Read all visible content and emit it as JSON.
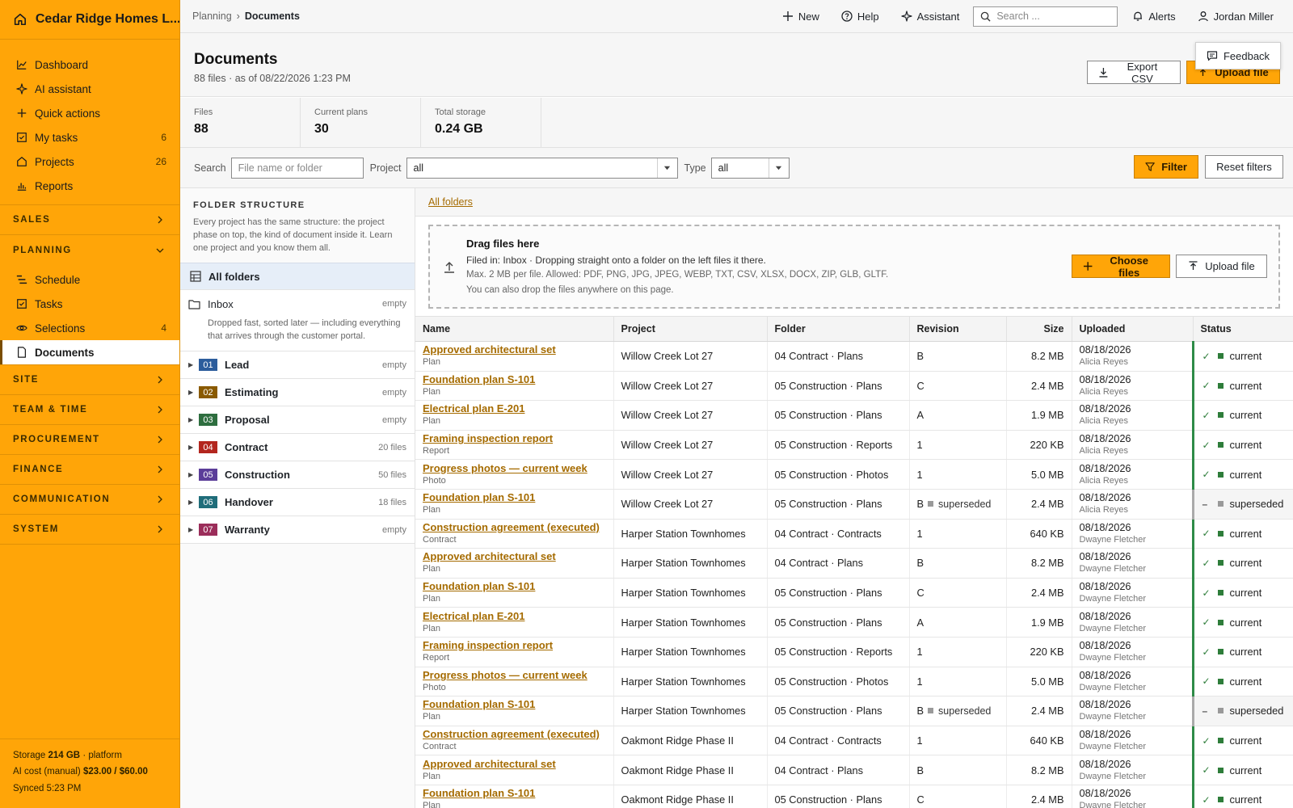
{
  "brand": {
    "name": "Cedar Ridge Homes L..."
  },
  "nav": {
    "top": [
      {
        "label": "Dashboard",
        "icon": "chart-line-icon",
        "count": ""
      },
      {
        "label": "AI assistant",
        "icon": "sparkle-icon",
        "count": ""
      },
      {
        "label": "Quick actions",
        "icon": "plus-icon",
        "count": ""
      },
      {
        "label": "My tasks",
        "icon": "checkbox-icon",
        "count": "6"
      },
      {
        "label": "Projects",
        "icon": "home-icon",
        "count": "26"
      },
      {
        "label": "Reports",
        "icon": "bar-chart-icon",
        "count": ""
      }
    ],
    "sections": {
      "sales": "SALES",
      "planning": "PLANNING",
      "site": "SITE",
      "team_time": "TEAM & TIME",
      "procurement": "PROCUREMENT",
      "finance": "FINANCE",
      "communication": "COMMUNICATION",
      "system": "SYSTEM"
    },
    "planning_items": [
      {
        "label": "Schedule",
        "count": ""
      },
      {
        "label": "Tasks",
        "count": ""
      },
      {
        "label": "Selections",
        "count": "4"
      },
      {
        "label": "Documents",
        "count": ""
      }
    ]
  },
  "footer": {
    "storage_label": "Storage",
    "storage_value": "214 GB",
    "storage_suffix": "· platform",
    "ai_label": "AI cost (manual)",
    "ai_value": "$23.00 / $60.00",
    "synced": "Synced 5:23 PM"
  },
  "topbar": {
    "crumb_parent": "Planning",
    "crumb_sep": "›",
    "crumb_current": "Documents",
    "new_label": "New",
    "help_label": "Help",
    "assistant_label": "Assistant",
    "search_placeholder": "Search ...",
    "alerts_label": "Alerts",
    "user_name": "Jordan Miller"
  },
  "header": {
    "title": "Documents",
    "subtitle": "88 files · as of 08/22/2026 1:23 PM",
    "export_label": "Export CSV",
    "upload_label": "Upload file",
    "feedback_label": "Feedback"
  },
  "stats": [
    {
      "label": "Files",
      "value": "88"
    },
    {
      "label": "Current plans",
      "value": "30"
    },
    {
      "label": "Total storage",
      "value": "0.24 GB"
    }
  ],
  "filters": {
    "search_label": "Search",
    "search_placeholder": "File name or folder",
    "project_label": "Project",
    "project_value": "all",
    "type_label": "Type",
    "type_value": "all",
    "filter_label": "Filter",
    "reset_label": "Reset filters"
  },
  "folders": {
    "title": "FOLDER STRUCTURE",
    "description": "Every project has the same structure: the project phase on top, the kind of document inside it. Learn one project and you know them all.",
    "all_label": "All folders",
    "inbox_label": "Inbox",
    "inbox_count": "empty",
    "inbox_note": "Dropped fast, sorted later — including everything that arrives through the customer portal.",
    "phases": [
      {
        "num": "01",
        "name": "Lead",
        "count": "empty",
        "color": "#2c5d9c"
      },
      {
        "num": "02",
        "name": "Estimating",
        "count": "empty",
        "color": "#8a5a00"
      },
      {
        "num": "03",
        "name": "Proposal",
        "count": "empty",
        "color": "#2e6e3f"
      },
      {
        "num": "04",
        "name": "Contract",
        "count": "20 files",
        "color": "#b3261e"
      },
      {
        "num": "05",
        "name": "Construction",
        "count": "50 files",
        "color": "#5b3d99"
      },
      {
        "num": "06",
        "name": "Handover",
        "count": "18 files",
        "color": "#1f6d7a"
      },
      {
        "num": "07",
        "name": "Warranty",
        "count": "empty",
        "color": "#9b2d5a"
      }
    ]
  },
  "main": {
    "all_folders_link": "All folders",
    "drop": {
      "title": "Drag files here",
      "line1": "Filed in: Inbox · Dropping straight onto a folder on the left files it there.",
      "line2": "Max. 2 MB per file. Allowed: PDF, PNG, JPG, JPEG, WEBP, TXT, CSV, XLSX, DOCX, ZIP, GLB, GLTF.",
      "line3": "You can also drop the files anywhere on this page.",
      "choose_label": "Choose files",
      "upload_label": "Upload file"
    }
  },
  "table": {
    "headers": {
      "name": "Name",
      "project": "Project",
      "folder": "Folder",
      "revision": "Revision",
      "size": "Size",
      "uploaded": "Uploaded",
      "status": "Status"
    },
    "rows": [
      {
        "name": "Approved architectural set",
        "cat": "Plan",
        "project": "Willow Creek Lot 27",
        "folder": "04 Contract · Plans",
        "rev": "B",
        "rev_status": "",
        "size": "8.2 MB",
        "date": "08/18/2026",
        "user": "Alicia Reyes",
        "status": "current"
      },
      {
        "name": "Foundation plan S-101",
        "cat": "Plan",
        "project": "Willow Creek Lot 27",
        "folder": "05 Construction · Plans",
        "rev": "C",
        "rev_status": "",
        "size": "2.4 MB",
        "date": "08/18/2026",
        "user": "Alicia Reyes",
        "status": "current"
      },
      {
        "name": "Electrical plan E-201",
        "cat": "Plan",
        "project": "Willow Creek Lot 27",
        "folder": "05 Construction · Plans",
        "rev": "A",
        "rev_status": "",
        "size": "1.9 MB",
        "date": "08/18/2026",
        "user": "Alicia Reyes",
        "status": "current"
      },
      {
        "name": "Framing inspection report",
        "cat": "Report",
        "project": "Willow Creek Lot 27",
        "folder": "05 Construction · Reports",
        "rev": "1",
        "rev_status": "",
        "size": "220 KB",
        "date": "08/18/2026",
        "user": "Alicia Reyes",
        "status": "current"
      },
      {
        "name": "Progress photos — current week",
        "cat": "Photo",
        "project": "Willow Creek Lot 27",
        "folder": "05 Construction · Photos",
        "rev": "1",
        "rev_status": "",
        "size": "5.0 MB",
        "date": "08/18/2026",
        "user": "Alicia Reyes",
        "status": "current"
      },
      {
        "name": "Foundation plan S-101",
        "cat": "Plan",
        "project": "Willow Creek Lot 27",
        "folder": "05 Construction · Plans",
        "rev": "B",
        "rev_status": "superseded",
        "size": "2.4 MB",
        "date": "08/18/2026",
        "user": "Alicia Reyes",
        "status": "superseded"
      },
      {
        "name": "Construction agreement (executed)",
        "cat": "Contract",
        "project": "Harper Station Townhomes",
        "folder": "04 Contract · Contracts",
        "rev": "1",
        "rev_status": "",
        "size": "640 KB",
        "date": "08/18/2026",
        "user": "Dwayne Fletcher",
        "status": "current"
      },
      {
        "name": "Approved architectural set",
        "cat": "Plan",
        "project": "Harper Station Townhomes",
        "folder": "04 Contract · Plans",
        "rev": "B",
        "rev_status": "",
        "size": "8.2 MB",
        "date": "08/18/2026",
        "user": "Dwayne Fletcher",
        "status": "current"
      },
      {
        "name": "Foundation plan S-101",
        "cat": "Plan",
        "project": "Harper Station Townhomes",
        "folder": "05 Construction · Plans",
        "rev": "C",
        "rev_status": "",
        "size": "2.4 MB",
        "date": "08/18/2026",
        "user": "Dwayne Fletcher",
        "status": "current"
      },
      {
        "name": "Electrical plan E-201",
        "cat": "Plan",
        "project": "Harper Station Townhomes",
        "folder": "05 Construction · Plans",
        "rev": "A",
        "rev_status": "",
        "size": "1.9 MB",
        "date": "08/18/2026",
        "user": "Dwayne Fletcher",
        "status": "current"
      },
      {
        "name": "Framing inspection report",
        "cat": "Report",
        "project": "Harper Station Townhomes",
        "folder": "05 Construction · Reports",
        "rev": "1",
        "rev_status": "",
        "size": "220 KB",
        "date": "08/18/2026",
        "user": "Dwayne Fletcher",
        "status": "current"
      },
      {
        "name": "Progress photos — current week",
        "cat": "Photo",
        "project": "Harper Station Townhomes",
        "folder": "05 Construction · Photos",
        "rev": "1",
        "rev_status": "",
        "size": "5.0 MB",
        "date": "08/18/2026",
        "user": "Dwayne Fletcher",
        "status": "current"
      },
      {
        "name": "Foundation plan S-101",
        "cat": "Plan",
        "project": "Harper Station Townhomes",
        "folder": "05 Construction · Plans",
        "rev": "B",
        "rev_status": "superseded",
        "size": "2.4 MB",
        "date": "08/18/2026",
        "user": "Dwayne Fletcher",
        "status": "superseded"
      },
      {
        "name": "Construction agreement (executed)",
        "cat": "Contract",
        "project": "Oakmont Ridge Phase II",
        "folder": "04 Contract · Contracts",
        "rev": "1",
        "rev_status": "",
        "size": "640 KB",
        "date": "08/18/2026",
        "user": "Dwayne Fletcher",
        "status": "current"
      },
      {
        "name": "Approved architectural set",
        "cat": "Plan",
        "project": "Oakmont Ridge Phase II",
        "folder": "04 Contract · Plans",
        "rev": "B",
        "rev_status": "",
        "size": "8.2 MB",
        "date": "08/18/2026",
        "user": "Dwayne Fletcher",
        "status": "current"
      },
      {
        "name": "Foundation plan S-101",
        "cat": "Plan",
        "project": "Oakmont Ridge Phase II",
        "folder": "05 Construction · Plans",
        "rev": "C",
        "rev_status": "",
        "size": "2.4 MB",
        "date": "08/18/2026",
        "user": "Dwayne Fletcher",
        "status": "current"
      }
    ]
  }
}
